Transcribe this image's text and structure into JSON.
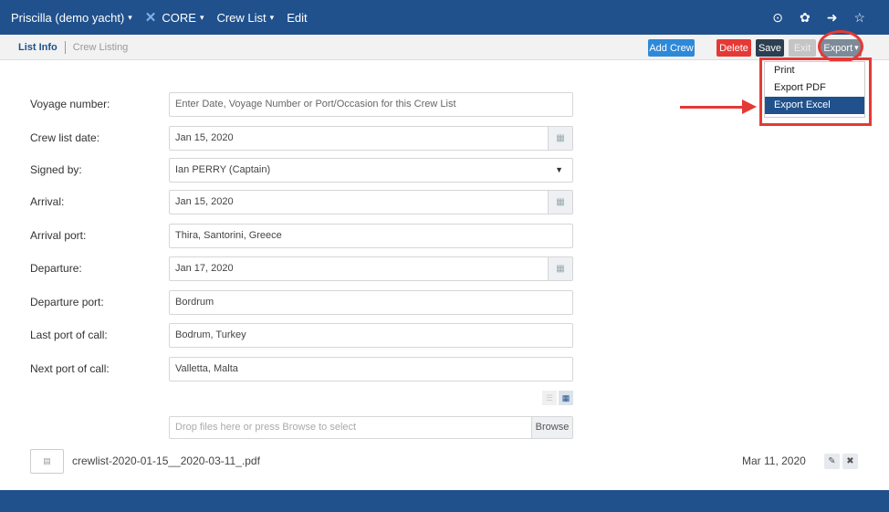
{
  "topbar": {
    "vessel": "Priscilla (demo yacht)",
    "core": "CORE",
    "crew_list": "Crew List",
    "edit": "Edit",
    "icons": [
      "clock-icon",
      "gear-icon",
      "logout-icon",
      "star-icon"
    ]
  },
  "toolbar": {
    "tab_list_info": "List Info",
    "tab_crew_listing": "Crew Listing",
    "add_crew": "Add Crew",
    "delete": "Delete",
    "save": "Save",
    "exit": "Exit",
    "export": "Export"
  },
  "export_menu": [
    "Print",
    "Export PDF",
    "Export Excel"
  ],
  "form": {
    "voyage_number": {
      "label": "Voyage number:",
      "placeholder": "Enter Date, Voyage Number or Port/Occasion for this Crew List"
    },
    "crew_list_date": {
      "label": "Crew list date:",
      "value": "Jan 15, 2020"
    },
    "signed_by": {
      "label": "Signed by:",
      "value": "Ian PERRY (Captain)"
    },
    "arrival": {
      "label": "Arrival:",
      "value": "Jan 15, 2020"
    },
    "arrival_port": {
      "label": "Arrival port:",
      "value": "Thira, Santorini, Greece"
    },
    "departure": {
      "label": "Departure:",
      "value": "Jan 17, 2020"
    },
    "departure_port": {
      "label": "Departure port:",
      "value": "Bordrum"
    },
    "last_port_of_call": {
      "label": "Last port of call:",
      "value": "Bodrum, Turkey"
    },
    "next_port_of_call": {
      "label": "Next port of call:",
      "value": "Valletta, Malta"
    }
  },
  "upload": {
    "dropzone_text": "Drop files here or press Browse to select",
    "browse": "Browse"
  },
  "file": {
    "name": "crewlist-2020-01-15__2020-03-11_.pdf",
    "date": "Mar 11, 2020"
  },
  "colors": {
    "primary": "#20518c",
    "add": "#2e89d8",
    "delete": "#e53935",
    "save": "#2c3e50",
    "annotation": "#e53935"
  }
}
